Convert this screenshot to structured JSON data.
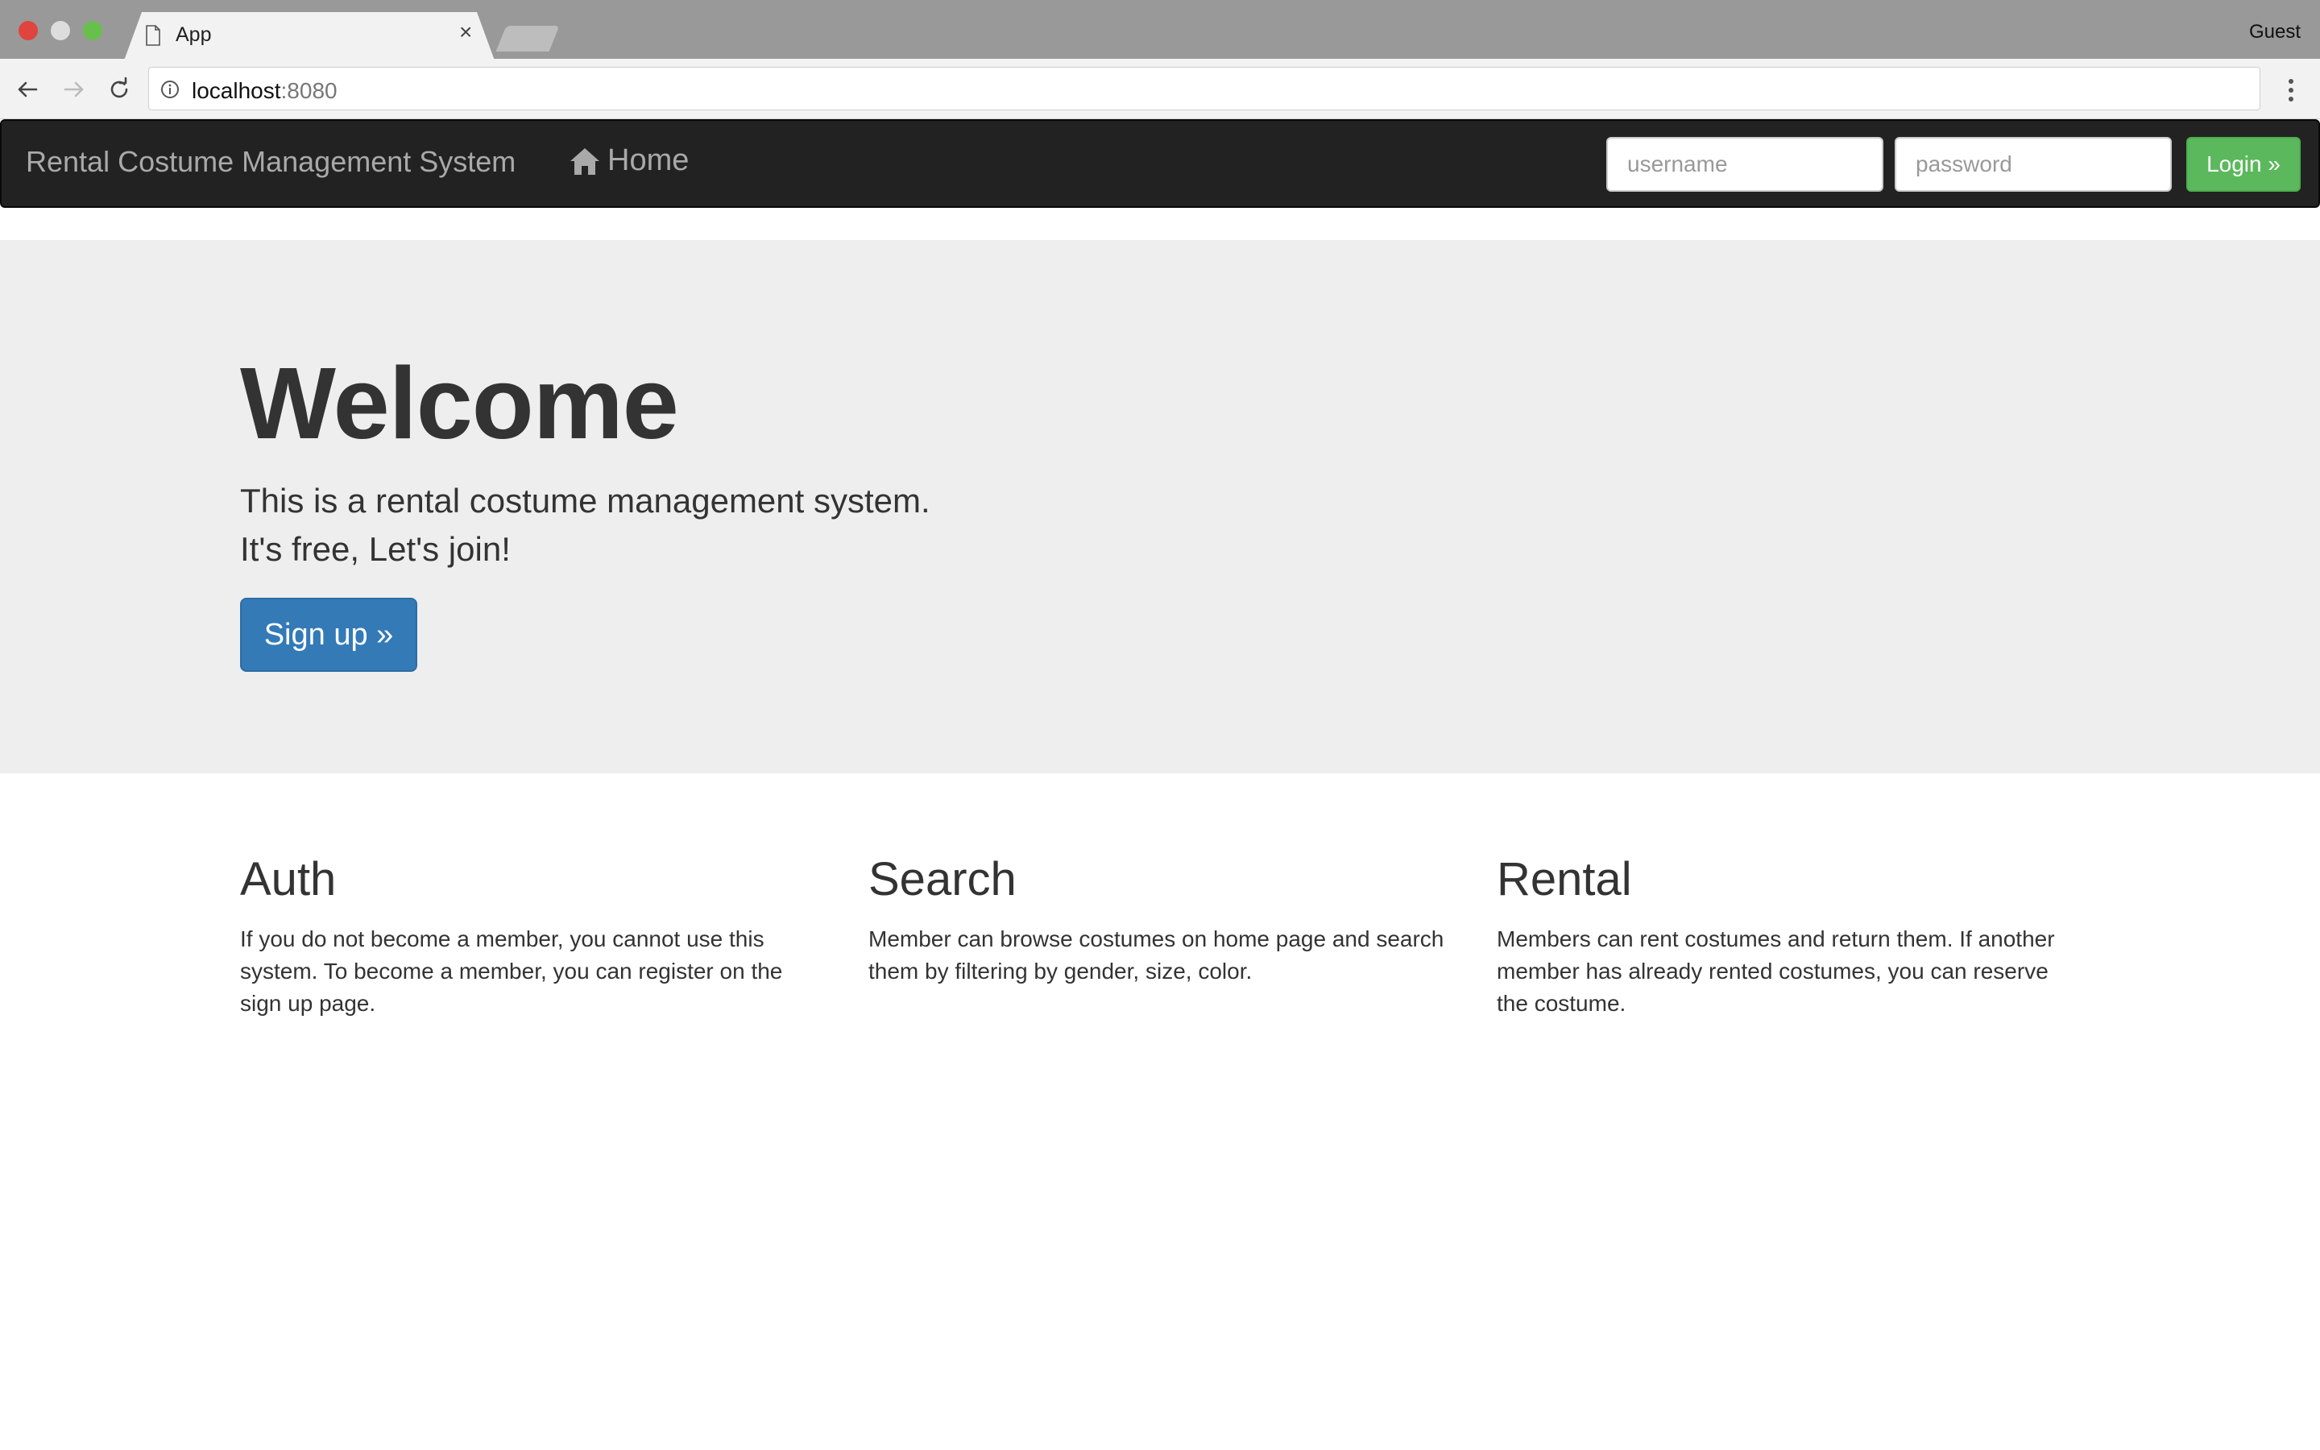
{
  "browser": {
    "tab_title": "App",
    "tab_close": "×",
    "profile": "Guest",
    "url_host": "localhost",
    "url_port": ":8080"
  },
  "navbar": {
    "brand": "Rental Costume Management System",
    "home_label": "Home",
    "username_placeholder": "username",
    "password_placeholder": "password",
    "login_label": "Login »"
  },
  "hero": {
    "title": "Welcome",
    "line1": "This is a rental costume management system.",
    "line2": "It's free, Let's join!",
    "signup_label": "Sign up »"
  },
  "features": [
    {
      "title": "Auth",
      "text": "If you do not become a member, you cannot use this system. To become a member, you can register on the sign up page."
    },
    {
      "title": "Search",
      "text": "Member can browse costumes on home page and search them by filtering by gender, size, color."
    },
    {
      "title": "Rental",
      "text": "Members can rent costumes and return them. If another member has already rented costumes, you can reserve the costume."
    }
  ],
  "colors": {
    "navbar_bg": "#222222",
    "login_green": "#5cb85c",
    "signup_blue": "#337ab7",
    "jumbotron_bg": "#eeeeee"
  }
}
